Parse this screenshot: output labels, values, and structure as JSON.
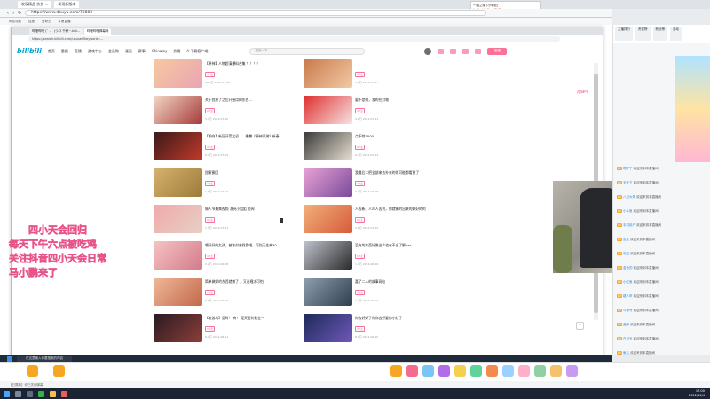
{
  "outer_browser": {
    "tabs": [
      "发现精品 扶贫 ...",
      "发现新版本"
    ],
    "url": "https://www.douyu.com/73802",
    "bookmarks": [
      "网站导航",
      "百度",
      "爱奇艺",
      "斗鱼直播"
    ]
  },
  "player": {
    "line1": "一路之缘 (小毛驼)",
    "line2": "JinBro(JinBro)/TUT"
  },
  "inner_browser": {
    "tabs": [
      "哔哩哔哩 (゜-゜)つロ 干杯~-bili...",
      "哔哩哔哩弹幕网"
    ],
    "url": "https://search.bilibili.com/upuser?keyword=..."
  },
  "bili": {
    "logo": "bilibili",
    "nav": [
      "首页",
      "番剧",
      "直播",
      "游戏中心",
      "会员购",
      "漫画",
      "赛事",
      "ChinaJoy",
      "热搜",
      "A  下载客户端"
    ],
    "search_placeholder": "搜索一下",
    "upload": "投稿",
    "side_promo": "月SPT"
  },
  "videos_left": [
    {
      "title": "【原神】人物超清爆料合集 ！！！！",
      "tag": "UP主",
      "meta": "16.1万  2022-07-28"
    },
    {
      "title": "关于我把了之后开始用的东西...",
      "tag": "UP主",
      "meta": "3.4万  2022-07-20"
    },
    {
      "title": "【明舟】新区开荒之初——播撒《原神深渊》新春",
      "tag": "UP主",
      "meta": "8.7万  2022-07-15"
    },
    {
      "title": "甜蜜蜜团",
      "tag": "UP主",
      "meta": "1.1万  2022-07-10"
    },
    {
      "title": "情人节最美视频 漂亮小姐姐 鱼闻",
      "tag": "UP主",
      "meta": "7.5万  2022-07-01"
    },
    {
      "title": "喂好好的女孩，被冰封来找我吧，可别天生来30",
      "tag": "UP主",
      "meta": "2.2万  2022-06-28"
    },
    {
      "title": "简单做好的东西就做了 ，又让睡太可怕",
      "tag": "UP主",
      "meta": "5.6万  2022-06-20"
    },
    {
      "title": "【旅游地】是时！ 有！ 是天里的能让一",
      "tag": "UP主",
      "meta": "9.9万  2022-06-11"
    }
  ],
  "videos_right": [
    {
      "title": "",
      "tag": "UP主",
      "meta": "1.2万  2022-07-27"
    },
    {
      "title": "要不是嗯，我的在对嗯",
      "tag": "UP主",
      "meta": "4.1万  2022-07-21"
    },
    {
      "title": "点不惊1000",
      "tag": "UP主",
      "meta": "6.3万  2022-07-14"
    },
    {
      "title": "我最后二把全部来去外来的你可能都看到了",
      "tag": "UP主",
      "meta": "3.0万  2022-07-08"
    },
    {
      "title": "人去新、人叫人去到，你就模的出来的好好的的",
      "tag": "UP主",
      "meta": "2.8万  2022-07-02"
    },
    {
      "title": "没有的东西好像这个也有不出了解bar",
      "tag": "UP主",
      "meta": "1.7万  2022-06-26"
    },
    {
      "title": "喜了二人的故事网站",
      "tag": "UP主",
      "meta": "4.4万  2022-06-19"
    },
    {
      "title": "你去好好了你你去好要你小红了",
      "tag": "UP主",
      "meta": "8.0万  2022-06-10"
    }
  ],
  "overlay_text": [
    "四小天会回归",
    "每天下午六点被吃鸡",
    "关注抖音四小天会日常",
    "马小鹏来了"
  ],
  "chat": {
    "tabs": [
      "主播排行",
      "贵宾榜",
      "粉丝榜",
      "活动"
    ],
    "messages": [
      {
        "badge": "LV",
        "name": "喝罗宁",
        "text": "欢迎来到本直播间"
      },
      {
        "badge": "LV",
        "name": "天天下",
        "text": "欢迎来到本直播间"
      },
      {
        "badge": "LV",
        "name": "八月大哥",
        "text": "欢迎来到本直播间"
      },
      {
        "badge": "LV",
        "name": "小斗鱼",
        "text": "欢迎来到本直播间"
      },
      {
        "badge": "LV",
        "name": "手机用户",
        "text": "欢迎来到本直播间"
      },
      {
        "badge": "LV",
        "name": "鱼友",
        "text": "欢迎来到本直播间"
      },
      {
        "badge": "LV",
        "name": "欢迎",
        "text": "欢迎来到本直播间"
      },
      {
        "badge": "LV",
        "name": "金色的",
        "text": "欢迎来到本直播间"
      },
      {
        "badge": "LV",
        "name": "小红鱼",
        "text": "欢迎来到本直播间"
      },
      {
        "badge": "LV",
        "name": "路人甲",
        "text": "欢迎来到本直播间"
      },
      {
        "badge": "LV",
        "name": "斗鱼号",
        "text": "欢迎来到本直播间"
      },
      {
        "badge": "LV",
        "name": "蓝鲸",
        "text": "欢迎来到本直播间"
      },
      {
        "badge": "LV",
        "name": "白月光",
        "text": "欢迎来到本直播间"
      },
      {
        "badge": "LV",
        "name": "鱼丸",
        "text": "欢迎来到本直播间"
      }
    ]
  },
  "bottom": {
    "inner_task_search": "在这里输入你要搜索的内容",
    "mute_line": "【已屏蔽】你已关闭弹幕",
    "clock_time": "17:00",
    "clock_date": "2022/12/4"
  }
}
